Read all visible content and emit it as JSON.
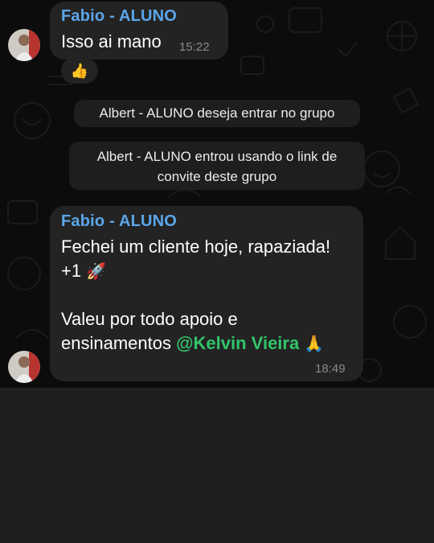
{
  "messages": [
    {
      "sender": "Fabio - ALUNO",
      "text": "Isso ai mano",
      "time": "15:22",
      "reaction_icon": "thumbs-up"
    },
    {
      "sender": "Fabio - ALUNO",
      "line1": "Fechei um cliente hoje, rapaziada!",
      "line2": "+1",
      "line2_icon": "rocket",
      "line3": "Valeu por todo apoio e",
      "line4_prefix": "ensinamentos ",
      "mention": "@Kelvin Vieira",
      "line4_icon": "folded-hands",
      "time": "18:49"
    }
  ],
  "system_messages": [
    {
      "line1": "Albert - ALUNO deseja entrar no grupo"
    },
    {
      "line1": "Albert - ALUNO entrou usando o link de",
      "line2": "convite deste grupo"
    }
  ],
  "colors": {
    "sender": "#5ba6ea",
    "mention": "#33c46a",
    "bubble": "#232323",
    "background": "#0c0c0c"
  }
}
